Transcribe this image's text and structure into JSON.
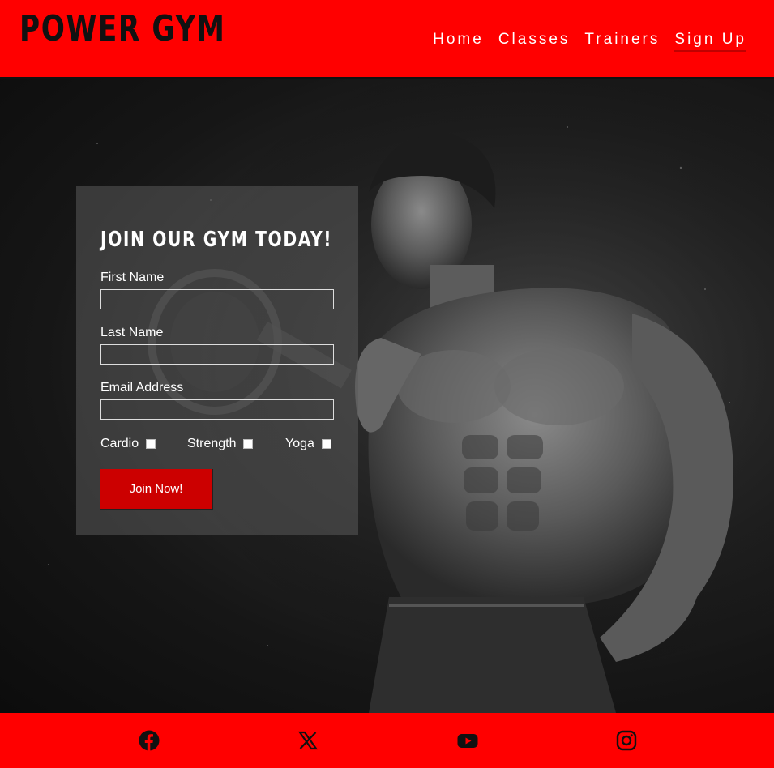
{
  "brand": {
    "logo": "POWER GYM"
  },
  "nav": {
    "items": [
      {
        "label": "Home",
        "active": false
      },
      {
        "label": "Classes",
        "active": false
      },
      {
        "label": "Trainers",
        "active": false
      },
      {
        "label": "Sign Up",
        "active": true
      }
    ]
  },
  "form": {
    "title": "JOIN OUR GYM TODAY!",
    "fields": [
      {
        "label": "First Name",
        "value": ""
      },
      {
        "label": "Last Name",
        "value": ""
      },
      {
        "label": "Email Address",
        "value": ""
      }
    ],
    "checkboxes": [
      {
        "label": "Cardio",
        "checked": false
      },
      {
        "label": "Strength",
        "checked": false
      },
      {
        "label": "Yoga",
        "checked": false
      }
    ],
    "submit_label": "Join Now!"
  },
  "footer": {
    "social_icons": [
      "facebook-icon",
      "x-icon",
      "youtube-icon",
      "instagram-icon"
    ]
  },
  "colors": {
    "brand_red": "#ff0000",
    "button_red": "#cc0000",
    "text_dark": "#111111",
    "text_light": "#ffffff"
  }
}
